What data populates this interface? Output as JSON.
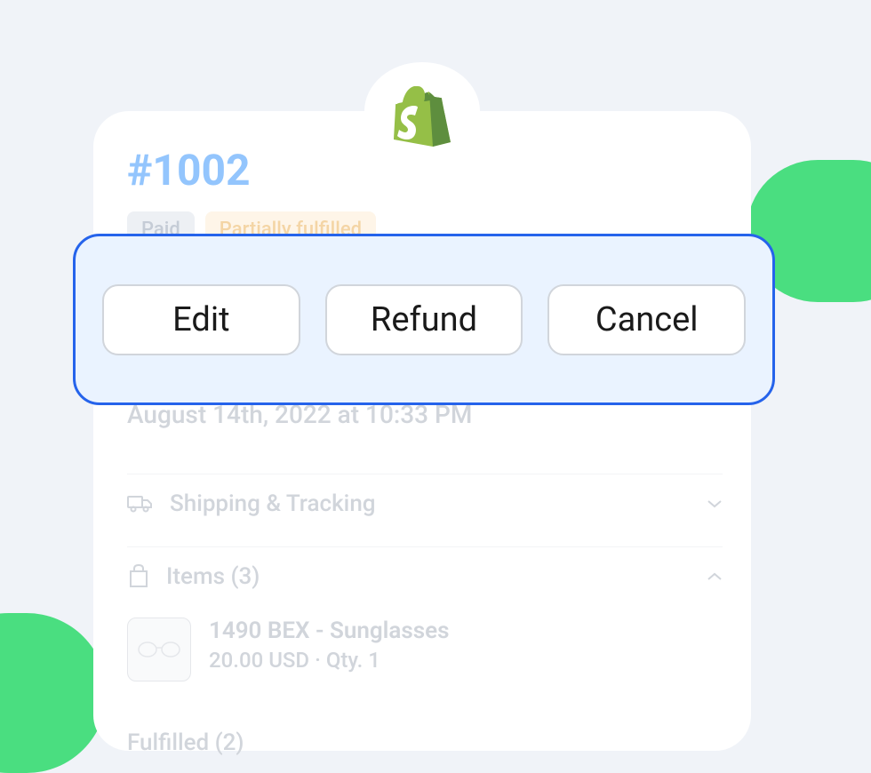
{
  "order": {
    "number": "#1002",
    "badges": {
      "paid": "Paid",
      "partial": "Partially fulfilled"
    },
    "timestamp": "August 14th, 2022 at 10:33 PM"
  },
  "actions": {
    "edit": "Edit",
    "refund": "Refund",
    "cancel": "Cancel"
  },
  "sections": {
    "shipping": "Shipping & Tracking",
    "items": "Items (3)"
  },
  "item": {
    "name": "1490 BEX - Sunglasses",
    "price_qty": "20.00 USD · Qty. 1"
  },
  "fulfilled": "Fulfilled (2)"
}
